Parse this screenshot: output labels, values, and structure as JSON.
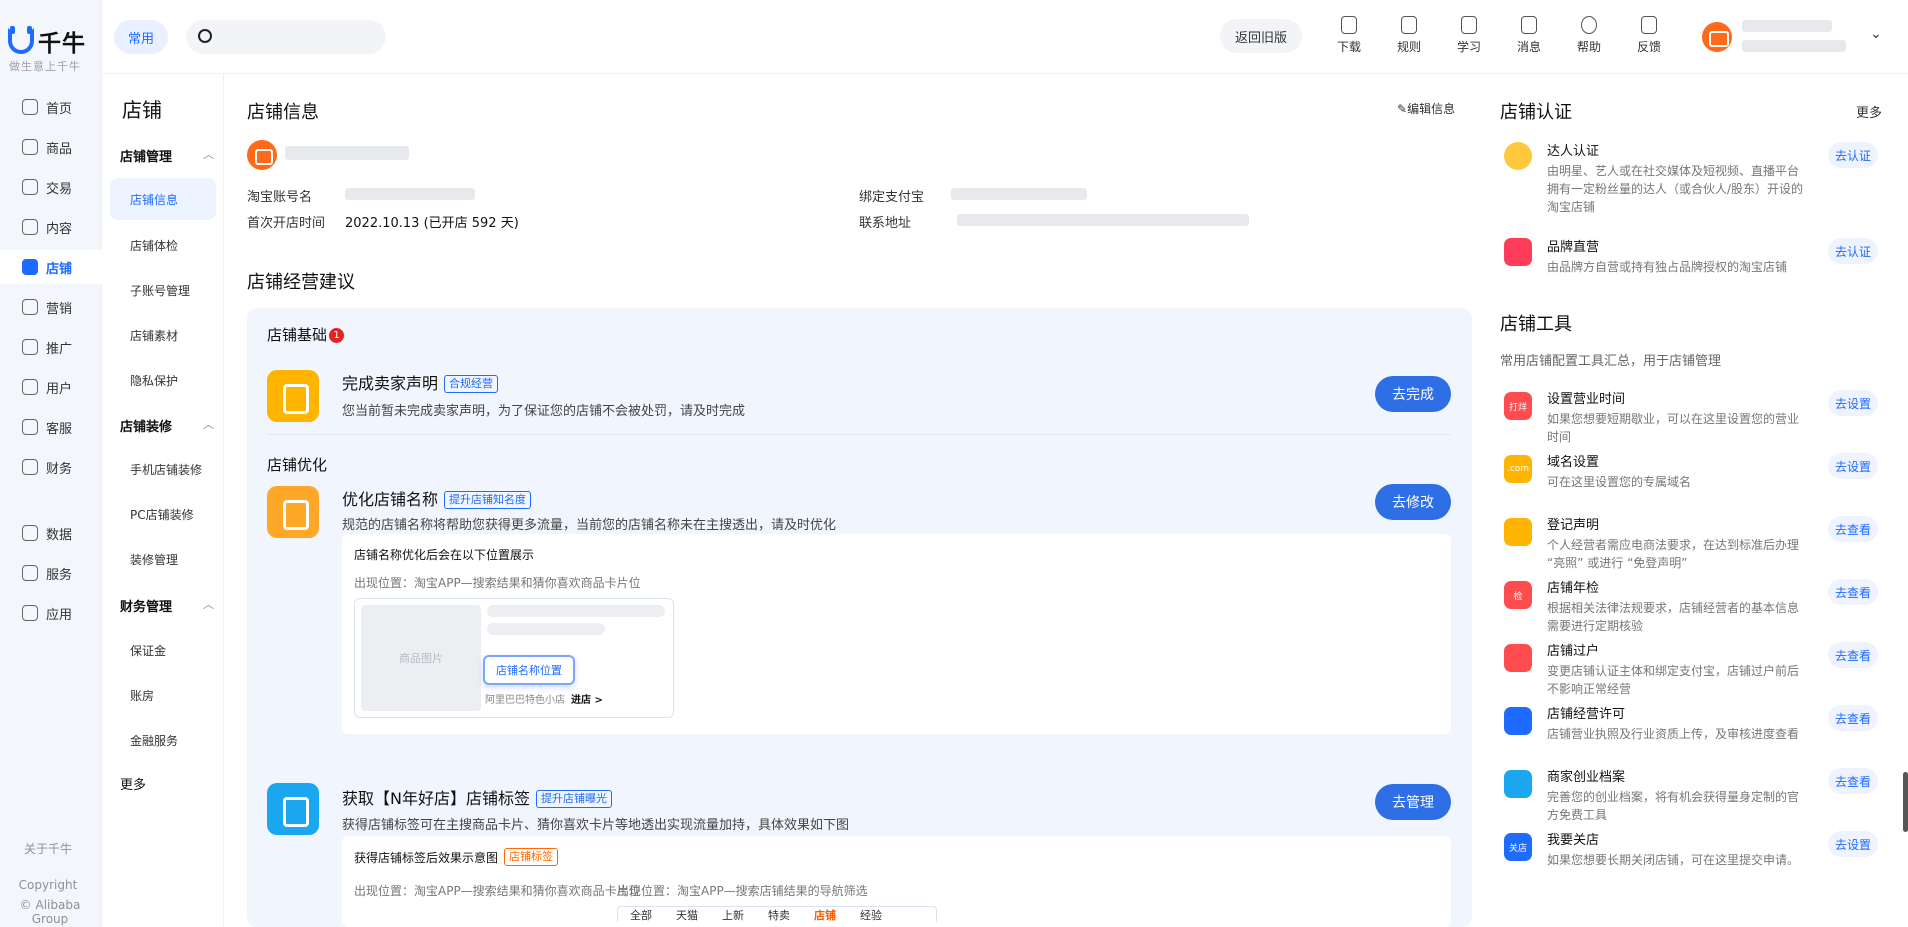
{
  "brand": {
    "name": "千牛",
    "slogan": "做生意上千牛"
  },
  "rail": {
    "items": [
      {
        "label": "首页",
        "icon": "home-icon"
      },
      {
        "label": "商品",
        "icon": "goods-icon"
      },
      {
        "label": "交易",
        "icon": "trade-icon"
      },
      {
        "label": "内容",
        "icon": "content-icon"
      },
      {
        "label": "店铺",
        "icon": "store-icon",
        "active": true
      },
      {
        "label": "营销",
        "icon": "marketing-icon"
      },
      {
        "label": "推广",
        "icon": "promotion-icon"
      },
      {
        "label": "用户",
        "icon": "user-icon"
      },
      {
        "label": "客服",
        "icon": "service-icon"
      },
      {
        "label": "财务",
        "icon": "finance-icon"
      },
      {
        "label": "数据",
        "icon": "data-icon"
      },
      {
        "label": "服务",
        "icon": "services-icon"
      },
      {
        "label": "应用",
        "icon": "apps-icon"
      }
    ],
    "about": "关于千牛",
    "copyright": "Copyright",
    "company": "© Alibaba Group"
  },
  "topbar": {
    "chip": "常用",
    "search_placeholder": "",
    "old_version": "返回旧版",
    "tools": [
      {
        "label": "下载",
        "icon": "download-icon"
      },
      {
        "label": "规则",
        "icon": "rules-icon"
      },
      {
        "label": "学习",
        "icon": "learn-icon"
      },
      {
        "label": "消息",
        "icon": "message-icon"
      },
      {
        "label": "帮助",
        "icon": "help-icon"
      },
      {
        "label": "反馈",
        "icon": "feedback-icon"
      }
    ]
  },
  "subnav": {
    "title": "店铺",
    "groups": [
      {
        "label": "店铺管理",
        "items": [
          "店铺信息",
          "店铺体检",
          "子账号管理",
          "店铺素材",
          "隐私保护"
        ]
      },
      {
        "label": "店铺装修",
        "items": [
          "手机店铺装修",
          "PC店铺装修",
          "装修管理"
        ]
      },
      {
        "label": "财务管理",
        "items": [
          "保证金",
          "账房",
          "金融服务"
        ]
      }
    ],
    "more": "更多"
  },
  "shop_info": {
    "title": "店铺信息",
    "edit": "编辑信息",
    "taobao_label": "淘宝账号名",
    "alipay_label": "绑定支付宝",
    "open_time_label": "首次开店时间",
    "open_time_value": "2022.10.13 (已开店 592 天)",
    "address_label": "联系地址"
  },
  "advice": {
    "title": "店铺经营建议",
    "basic_section": "店铺基础",
    "basic_badge": "1",
    "optimize_section": "店铺优化",
    "tasks": [
      {
        "title": "完成卖家声明",
        "tag": "合规经营",
        "desc": "您当前暂未完成卖家声明，为了保证您的店铺不会被处罚，请及时完成",
        "button": "去完成",
        "color": "#ffb400"
      },
      {
        "title": "优化店铺名称",
        "tag": "提升店铺知名度",
        "desc": "规范的店铺名称将帮助您获得更多流量，当前您的店铺名称未在主搜透出，请及时优化",
        "button": "去修改",
        "color": "#ffa726"
      },
      {
        "title": "获取【N年好店】店铺标签",
        "tag": "提升店铺曝光",
        "desc": "获得店铺标签可在主搜商品卡片、猜你喜欢卡片等地透出实现流量加持，具体效果如下图",
        "button": "去管理",
        "color": "#1aa7f0"
      }
    ],
    "name_card": {
      "title": "店铺名称优化后会在以下位置展示",
      "where": "出现位置：淘宝APP—搜索结果和猜你喜欢商品卡片位",
      "image_label": "商品图片",
      "position_chip": "店铺名称位置",
      "shop_name": "阿里巴巴特色小店",
      "enter": "进店 >"
    },
    "tag_card": {
      "title": "获得店铺标签后效果示意图",
      "tag": "店铺标签",
      "where1": "出现位置：淘宝APP—搜索结果和猜你喜欢商品卡片位",
      "where2": "出现位置：淘宝APP—搜索店铺结果的导航筛选",
      "filters": [
        "全部",
        "天猫",
        "上新",
        "特卖",
        "店铺",
        "经验"
      ]
    }
  },
  "certification": {
    "title": "店铺认证",
    "more": "更多",
    "items": [
      {
        "title": "达人认证",
        "desc": "由明星、艺人或在社交媒体及短视频、直播平台拥有一定粉丝量的达人（或合伙人/股东）开设的淘宝店铺",
        "button": "去认证",
        "color": "#ffc83d"
      },
      {
        "title": "品牌直营",
        "desc": "由品牌方自营或持有独占品牌授权的淘宝店铺",
        "button": "去认证",
        "color": "#ff3d5a"
      }
    ]
  },
  "tools": {
    "title": "店铺工具",
    "desc": "常用店铺配置工具汇总，用于店铺管理",
    "items": [
      {
        "title": "设置营业时间",
        "desc": "如果您想要短期歇业，可以在这里设置您的营业时间",
        "button": "去设置",
        "color": "#ff4d4f",
        "icon_text": "打烊"
      },
      {
        "title": "域名设置",
        "desc": "可在这里设置您的专属域名",
        "button": "去设置",
        "color": "#ffb400",
        "icon_text": ".com"
      },
      {
        "title": "登记声明",
        "desc": "个人经营者需应电商法要求，在达到标准后办理 “亮照” 或进行 “免登声明”",
        "button": "去查看",
        "color": "#ffb400",
        "icon_text": ""
      },
      {
        "title": "店铺年检",
        "desc": "根据相关法律法规要求，店铺经营者的基本信息需要进行定期核验",
        "button": "去查看",
        "color": "#ff4d4f",
        "icon_text": "检"
      },
      {
        "title": "店铺过户",
        "desc": "变更店铺认证主体和绑定支付宝，店铺过户前后不影响正常经营",
        "button": "去查看",
        "color": "#ff4d4f",
        "icon_text": ""
      },
      {
        "title": "店铺经营许可",
        "desc": "店铺营业执照及行业资质上传，及审核进度查看",
        "button": "去查看",
        "color": "#1e6bff",
        "icon_text": ""
      },
      {
        "title": "商家创业档案",
        "desc": "完善您的创业档案，将有机会获得量身定制的官方免费工具",
        "button": "去查看",
        "color": "#1aa7f0",
        "icon_text": ""
      },
      {
        "title": "我要关店",
        "desc": "如果您想要长期关闭店铺，可在这里提交申请。",
        "button": "去设置",
        "color": "#1e6bff",
        "icon_text": "关店"
      }
    ]
  }
}
